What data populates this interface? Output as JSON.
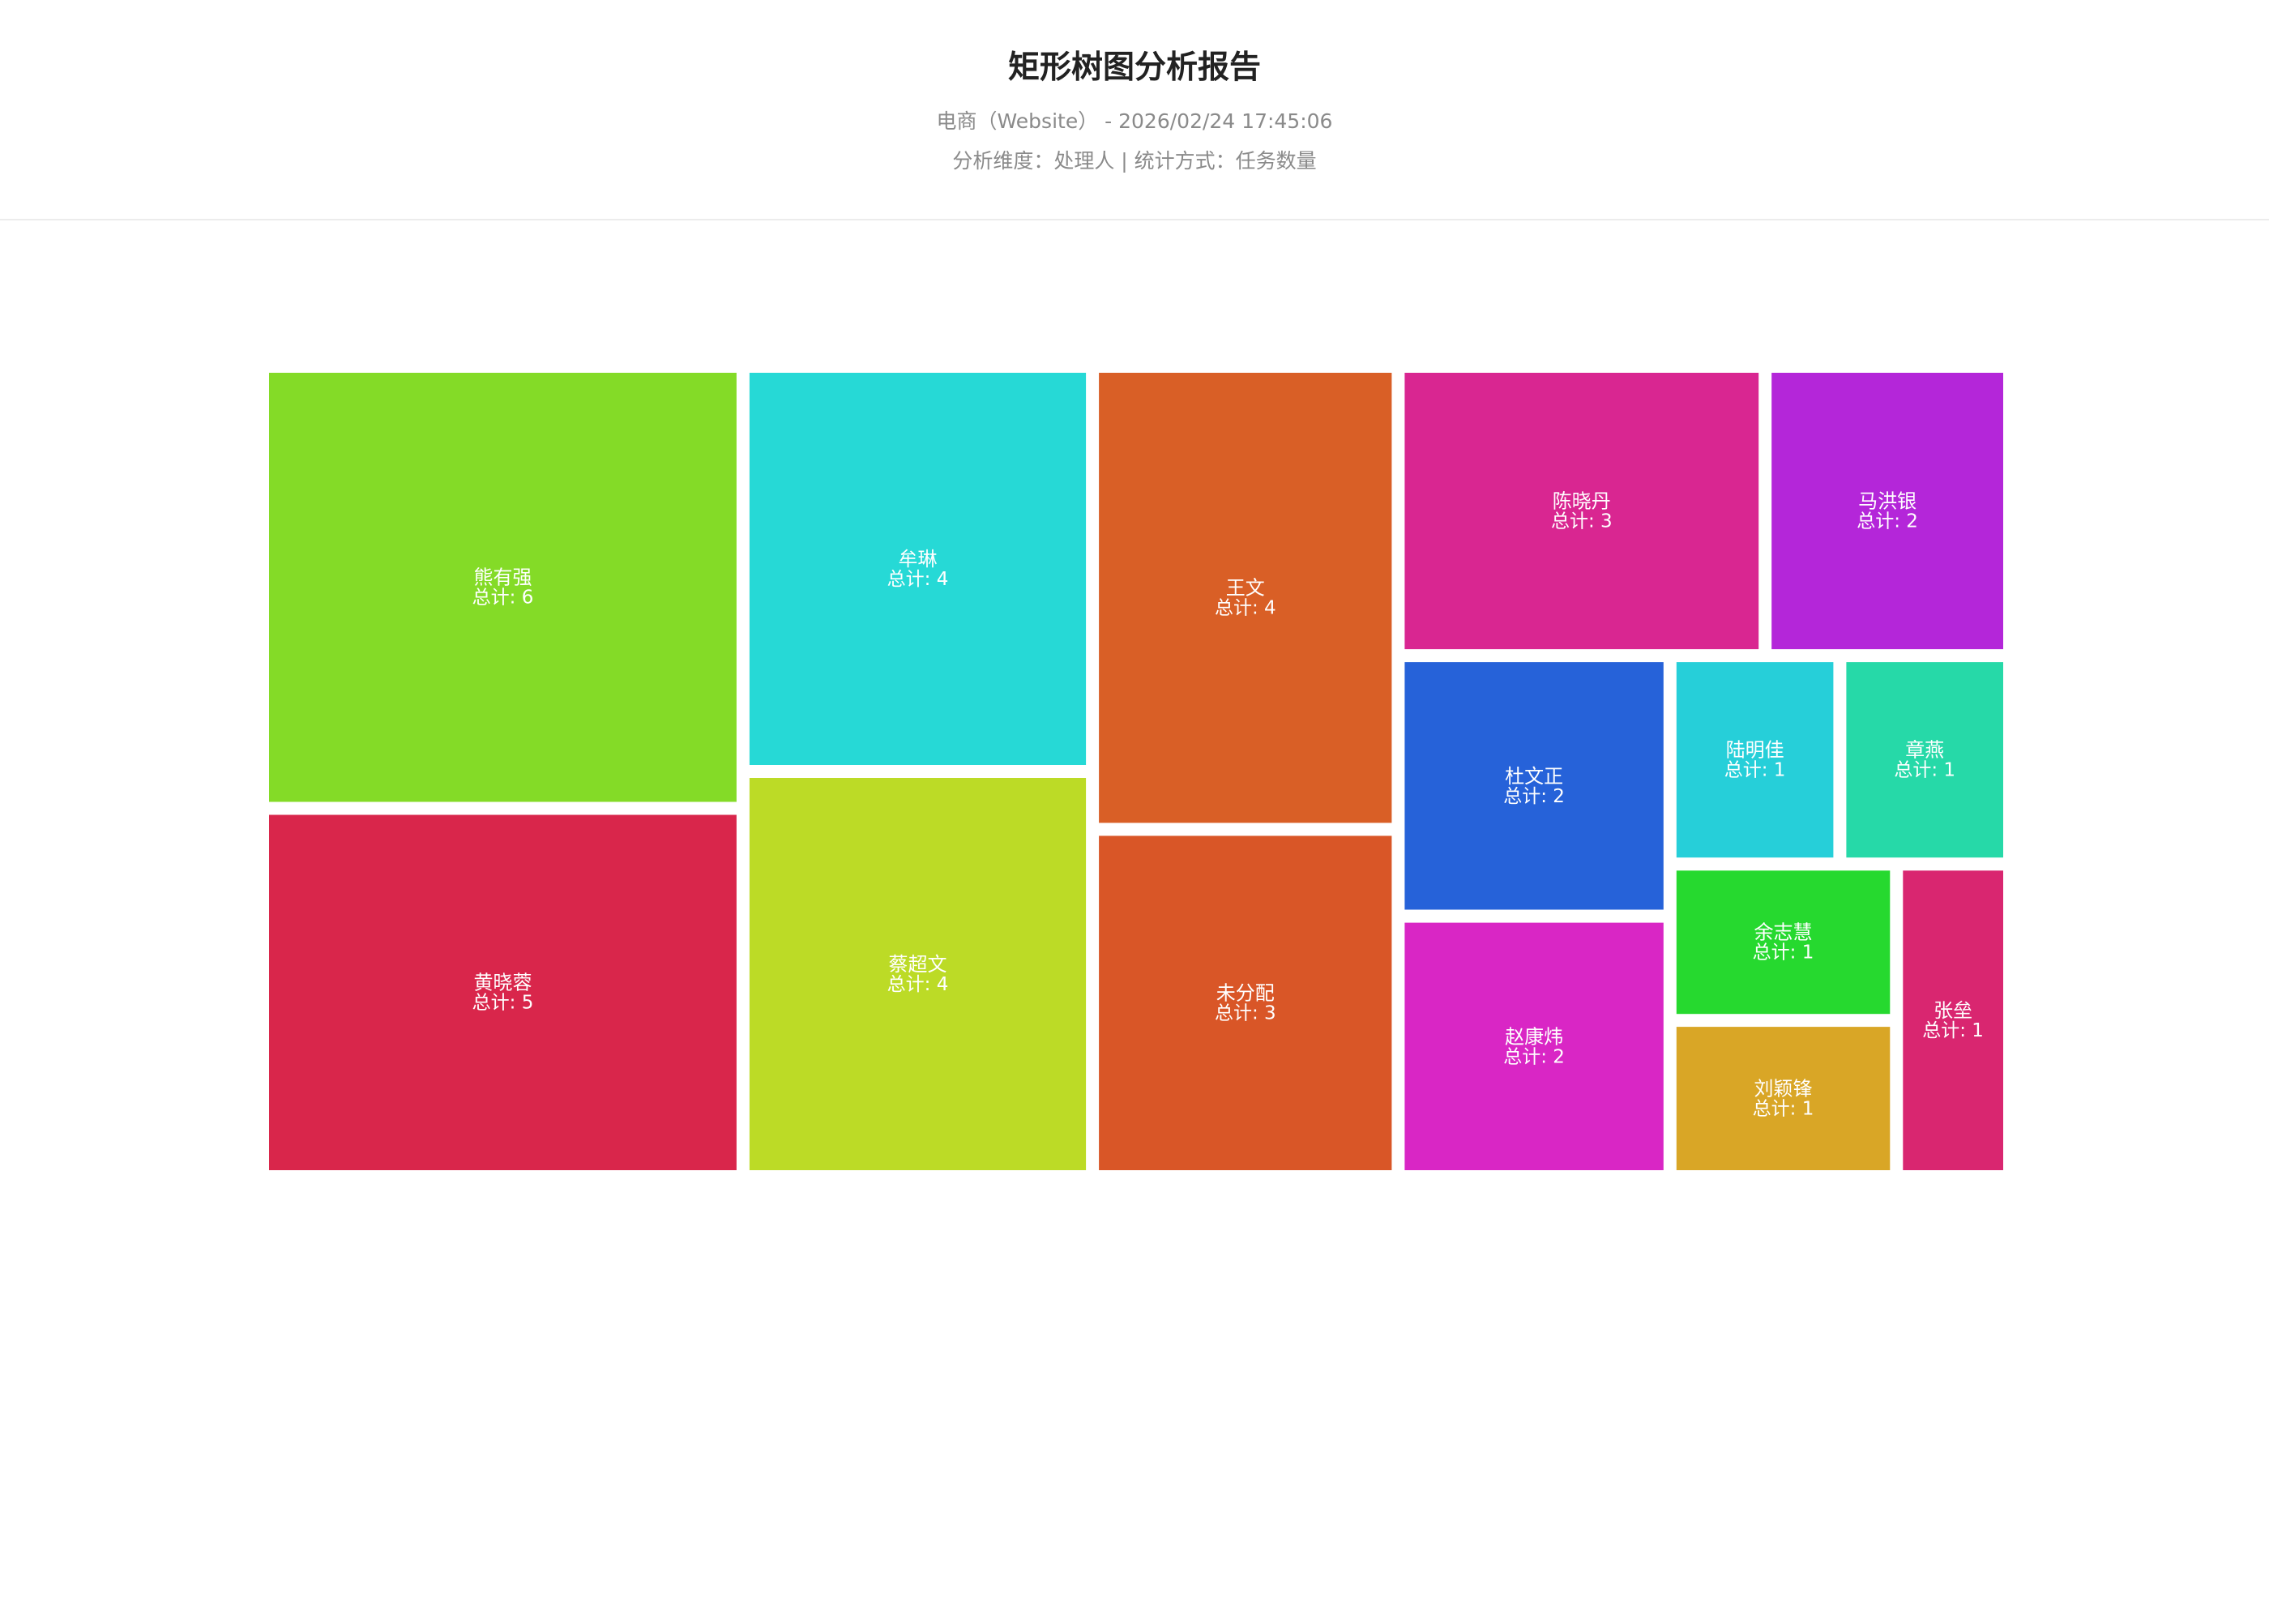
{
  "header": {
    "title": "矩形树图分析报告",
    "subtitle": "电商（Website） - 2026/02/24 17:45:06",
    "meta": "分析维度：处理人 | 统计方式：任务数量"
  },
  "chart_data": {
    "type": "treemap",
    "total_label": "总计",
    "items": [
      {
        "name": "熊有强",
        "value": 6,
        "color": "#84db27"
      },
      {
        "name": "黄晓蓉",
        "value": 5,
        "color": "#d9264b"
      },
      {
        "name": "牟琳",
        "value": 4,
        "color": "#26d9d6"
      },
      {
        "name": "蔡超文",
        "value": 4,
        "color": "#bcdb26"
      },
      {
        "name": "王文",
        "value": 4,
        "color": "#d95f26"
      },
      {
        "name": "未分配",
        "value": 3,
        "color": "#d95627"
      },
      {
        "name": "陈晓丹",
        "value": 3,
        "color": "#d92691"
      },
      {
        "name": "马洪银",
        "value": 2,
        "color": "#b426d9"
      },
      {
        "name": "杜文正",
        "value": 2,
        "color": "#2662d9"
      },
      {
        "name": "赵康炜",
        "value": 2,
        "color": "#d926c5"
      },
      {
        "name": "陆明佳",
        "value": 1,
        "color": "#26cfd9"
      },
      {
        "name": "章燕",
        "value": 1,
        "color": "#26d9a8"
      },
      {
        "name": "余志慧",
        "value": 1,
        "color": "#26d92f"
      },
      {
        "name": "刘颖锋",
        "value": 1,
        "color": "#d9a626"
      },
      {
        "name": "张垒",
        "value": 1,
        "color": "#d92670"
      }
    ]
  }
}
